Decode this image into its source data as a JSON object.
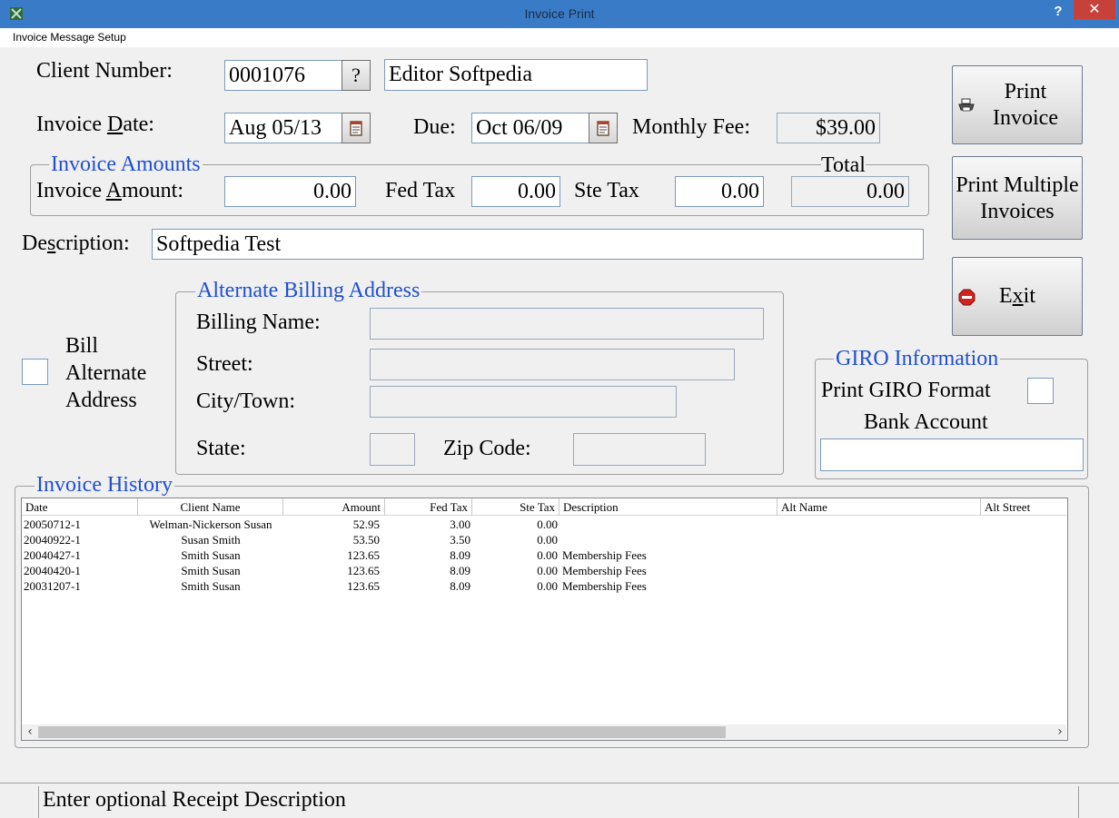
{
  "window": {
    "title": "Invoice Print",
    "help_glyph": "?",
    "close_glyph": "✕"
  },
  "menu": {
    "items": [
      "Invoice Message Setup"
    ]
  },
  "client": {
    "label": "Client Number:",
    "number": "0001076",
    "lookup_label": "?",
    "name": "Editor Softpedia"
  },
  "dates": {
    "invoice_date_label_pre": "Invoice ",
    "invoice_date_label_u": "D",
    "invoice_date_label_post": "ate:",
    "invoice_date": "Aug 05/13",
    "due_label": "Due:",
    "due_date": "Oct 06/09",
    "monthly_fee_label": "Monthly Fee:",
    "monthly_fee": "$39.00"
  },
  "amounts": {
    "legend": "Invoice Amounts",
    "total_label": "Total",
    "invoice_amount_label_pre": "Invoice ",
    "invoice_amount_label_u": "A",
    "invoice_amount_label_post": "mount:",
    "invoice_amount": "0.00",
    "fed_tax_label": "Fed Tax",
    "fed_tax": "0.00",
    "ste_tax_label": "Ste Tax",
    "ste_tax": "0.00",
    "total": "0.00"
  },
  "description": {
    "label_pre": "De",
    "label_u": "s",
    "label_post": "cription:",
    "value": "Softpedia Test"
  },
  "alt_billing": {
    "checkbox_label_line1": "Bill",
    "checkbox_label_line2": "Alternate",
    "checkbox_label_line3": "Address",
    "legend": "Alternate Billing Address",
    "billing_name_label": "Billing Name:",
    "billing_name": "",
    "street_label": "Street:",
    "street": "",
    "city_label": "City/Town:",
    "city": "",
    "state_label": "State:",
    "state": "",
    "zip_label": "Zip Code:",
    "zip": ""
  },
  "buttons": {
    "print_invoice_line1": "Print",
    "print_invoice_line2": "Invoice",
    "print_multiple_line1": "Print Multiple",
    "print_multiple_line2": "Invoices",
    "exit_pre": "E",
    "exit_u": "x",
    "exit_post": "it"
  },
  "giro": {
    "legend": "GIRO Information",
    "print_format_label": "Print GIRO Format",
    "bank_account_label": "Bank Account",
    "bank_account": ""
  },
  "history": {
    "legend": "Invoice History",
    "columns": [
      "Date",
      "Client Name",
      "Amount",
      "Fed Tax",
      "Ste Tax",
      "Description",
      "Alt Name",
      "Alt Street"
    ],
    "rows": [
      [
        "20050712-1",
        "Welman-Nickerson Susan",
        "52.95",
        "3.00",
        "0.00",
        ""
      ],
      [
        "20040922-1",
        "Susan Smith",
        "53.50",
        "3.50",
        "0.00",
        ""
      ],
      [
        "20040427-1",
        "Smith Susan",
        "123.65",
        "8.09",
        "0.00",
        "Membership Fees"
      ],
      [
        "20040420-1",
        "Smith Susan",
        "123.65",
        "8.09",
        "0.00",
        "Membership Fees"
      ],
      [
        "20031207-1",
        "Smith Susan",
        "123.65",
        "8.09",
        "0.00",
        "Membership Fees"
      ]
    ],
    "scroll_left": "‹",
    "scroll_right": "›"
  },
  "status": {
    "text": "Enter optional Receipt Description"
  },
  "colors": {
    "titlebar": "#3a7bc8",
    "close": "#c7413b",
    "legend_blue": "#1f4fd3"
  }
}
